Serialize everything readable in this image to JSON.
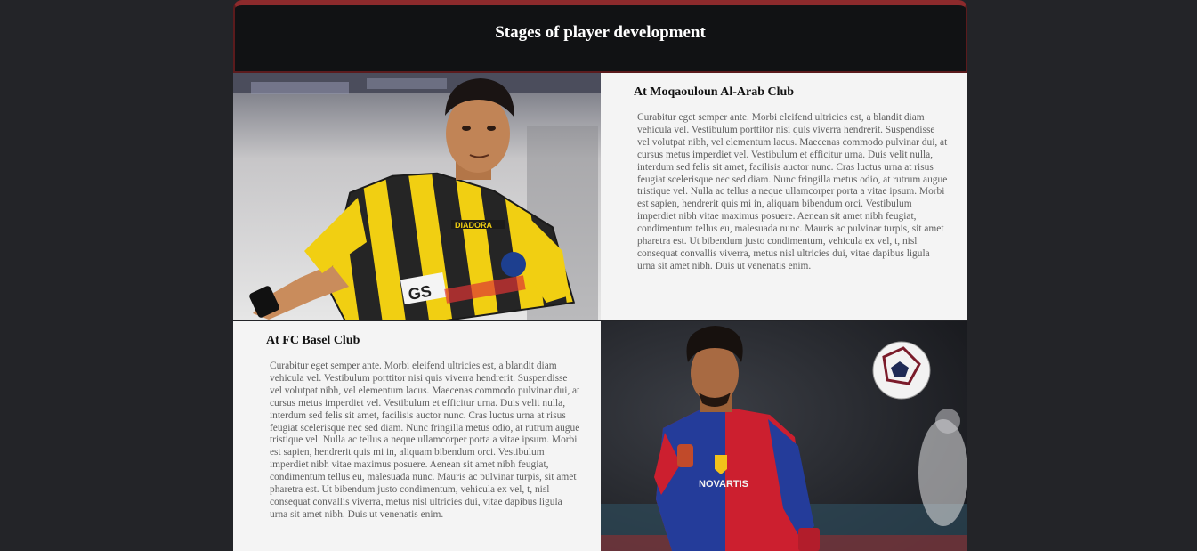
{
  "page": {
    "title": "Stages of player development"
  },
  "sections": [
    {
      "heading": "At Moqaouloun Al-Arab Club",
      "body": "Curabitur eget semper ante. Morbi eleifend ultricies est, a blandit diam vehicula vel. Vestibulum porttitor nisi quis viverra hendrerit. Suspendisse vel volutpat nibh, vel elementum lacus. Maecenas commodo pulvinar dui, at cursus metus imperdiet vel. Vestibulum et efficitur urna. Duis velit nulla, interdum sed felis sit amet, facilisis auctor nunc. Cras luctus urna at risus feugiat scelerisque nec sed diam. Nunc fringilla metus odio, at rutrum augue tristique vel. Nulla ac tellus a neque ullamcorper porta a vitae ipsum. Morbi est sapien, hendrerit quis mi in, aliquam bibendum orci. Vestibulum imperdiet nibh vitae maximus posuere. Aenean sit amet nibh feugiat, condimentum tellus eu, malesuada nunc. Mauris ac pulvinar turpis, sit amet pharetra est. Ut bibendum justo condimentum, vehicula ex vel, t, nisl consequat convallis viverra, metus nisl ultricies dui, vitae dapibus ligula urna sit amet nibh. Duis ut venenatis enim.",
      "photo_kit_text": [
        "DIADORA",
        "GS"
      ]
    },
    {
      "heading": "At FC Basel Club",
      "body": "Curabitur eget semper ante. Morbi eleifend ultricies est, a blandit diam vehicula vel. Vestibulum porttitor nisi quis viverra hendrerit. Suspendisse vel volutpat nibh, vel elementum lacus. Maecenas commodo pulvinar dui, at cursus metus imperdiet vel. Vestibulum et efficitur urna. Duis velit nulla, interdum sed felis sit amet, facilisis auctor nunc. Cras luctus urna at risus feugiat scelerisque nec sed diam. Nunc fringilla metus odio, at rutrum augue tristique vel. Nulla ac tellus a neque ullamcorper porta a vitae ipsum. Morbi est sapien, hendrerit quis mi in, aliquam bibendum orci. Vestibulum imperdiet nibh vitae maximus posuere. Aenean sit amet nibh feugiat, condimentum tellus eu, malesuada nunc. Mauris ac pulvinar turpis, sit amet pharetra est. Ut bibendum justo condimentum, vehicula ex vel, t, nisl consequat convallis viverra, metus nisl ultricies dui, vitae dapibus ligula urna sit amet nibh. Duis ut venenatis enim.",
      "photo_kit_text": [
        "NOVARTIS"
      ]
    }
  ],
  "colors": {
    "page_background": "#232428",
    "header_background": "#111214",
    "header_accent": "#8d2a2c",
    "panel_background": "#f4f4f4",
    "heading_text": "#111111",
    "body_text": "#5e5e5e"
  }
}
